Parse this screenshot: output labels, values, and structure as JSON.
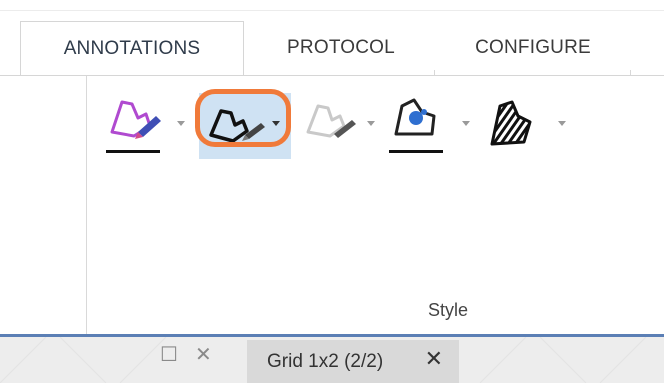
{
  "ribbon": {
    "tabs": [
      {
        "label": "ANNOTATIONS",
        "active": true
      },
      {
        "label": "PROTOCOL",
        "active": false
      },
      {
        "label": "CONFIGURE",
        "active": false
      }
    ],
    "group_label": "Style",
    "tools": [
      {
        "name": "line-color-tool",
        "icon": "pen-color-icon",
        "has_dropdown": true
      },
      {
        "name": "line-style-tool",
        "icon": "pen-shape-icon",
        "has_dropdown": true,
        "selected": true,
        "highlighted": true
      },
      {
        "name": "line-thickness-tool",
        "icon": "pen-faded-icon",
        "has_dropdown": true
      },
      {
        "name": "fill-color-tool",
        "icon": "paint-bucket-icon",
        "has_dropdown": true
      },
      {
        "name": "fill-pattern-tool",
        "icon": "pattern-shape-icon",
        "has_dropdown": true
      }
    ],
    "colors": {
      "highlight_ring": "#f07a3a",
      "selected_bg": "#cfe2f3",
      "accent_rule": "#5b7fb5"
    }
  },
  "bottom_bar": {
    "restore_glyph": "☐",
    "close_glyph": "✕",
    "doc_tab": {
      "label": "Grid 1x2 (2/2)",
      "close_glyph": "✕"
    }
  }
}
